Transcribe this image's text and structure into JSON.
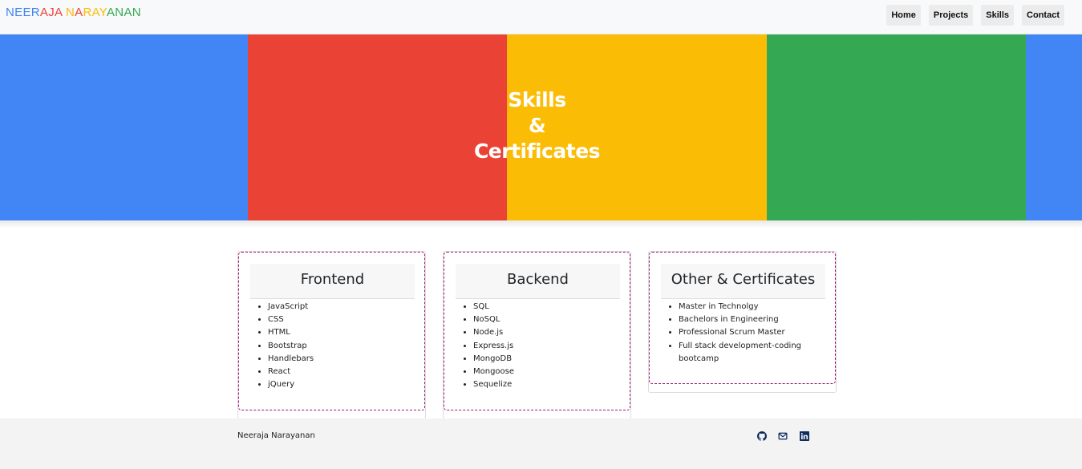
{
  "brand": {
    "letters": [
      {
        "ch": "N",
        "color": "#4285f4"
      },
      {
        "ch": "E",
        "color": "#4285f4"
      },
      {
        "ch": "E",
        "color": "#4285f4"
      },
      {
        "ch": "R",
        "color": "#4285f4"
      },
      {
        "ch": "A",
        "color": "#ea4335"
      },
      {
        "ch": "J",
        "color": "#ea4335"
      },
      {
        "ch": "A",
        "color": "#ea4335"
      },
      {
        "ch": " ",
        "color": "#ffffff"
      },
      {
        "ch": "N",
        "color": "#fbbc05"
      },
      {
        "ch": "A",
        "color": "#ea4335"
      },
      {
        "ch": "R",
        "color": "#fbbc05"
      },
      {
        "ch": "A",
        "color": "#fbbc05"
      },
      {
        "ch": "Y",
        "color": "#fbbc05"
      },
      {
        "ch": "A",
        "color": "#34a853"
      },
      {
        "ch": "N",
        "color": "#34a853"
      },
      {
        "ch": "A",
        "color": "#34a853"
      },
      {
        "ch": "N",
        "color": "#34a853"
      }
    ]
  },
  "nav": {
    "items": [
      "Home",
      "Projects",
      "Skills",
      "Contact"
    ]
  },
  "hero": {
    "title_lines": [
      "Skills",
      "&",
      "Certificates"
    ],
    "stripe_colors": [
      "#4285f4",
      "#ea4335",
      "#fbbc05",
      "#34a853",
      "#4285f4"
    ]
  },
  "cards": [
    {
      "title": "Frontend",
      "items": [
        "JavaScript",
        "CSS",
        "HTML",
        "Bootstrap",
        "Handlebars",
        "React",
        "jQuery"
      ]
    },
    {
      "title": "Backend",
      "items": [
        "SQL",
        "NoSQL",
        "Node.js",
        "Express.js",
        "MongoDB",
        "Mongoose",
        "Sequelize"
      ]
    },
    {
      "title": "Other & Certificates",
      "items": [
        "Master in Technolgy",
        "Bachelors in Engineering",
        "Professional Scrum Master",
        "Full stack development-coding bootcamp"
      ]
    }
  ],
  "footer": {
    "name": "Neeraja Narayanan",
    "icons": [
      "github-icon",
      "mail-icon",
      "linkedin-icon"
    ],
    "icon_color": "#0d2a5c"
  },
  "colors": {
    "card_border": "#a1157c"
  }
}
